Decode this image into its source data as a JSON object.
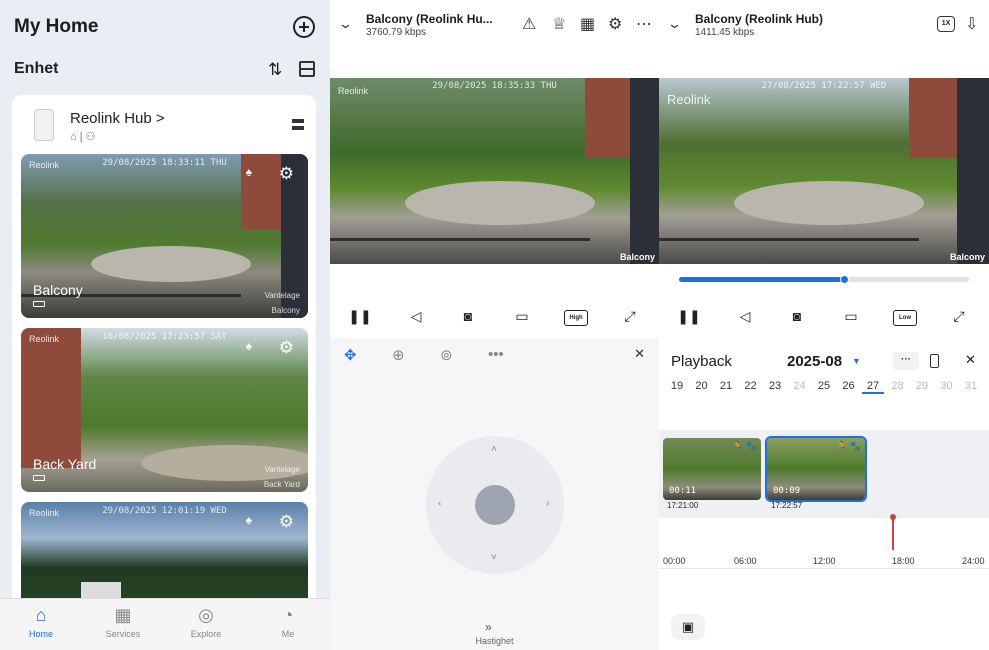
{
  "left": {
    "title": "My Home",
    "section": "Enhet",
    "hub": {
      "name": "Reolink Hub",
      "arrow": ">"
    },
    "cameras": [
      {
        "name": "Balcony",
        "timestamp": "29/08/2025 18:33:11 THU",
        "logo": "Reolink",
        "tag": "Vantelage",
        "label": "Balcony"
      },
      {
        "name": "Back Yard",
        "timestamp": "16/08/2025 17:23:57 SAT",
        "logo": "Reolink",
        "tag": "Vantelage",
        "label": "Back Yard"
      },
      {
        "name": "",
        "timestamp": "29/08/2025 12:01:19 WED",
        "logo": "Reolink",
        "tag": "",
        "label": ""
      }
    ],
    "tabs": [
      {
        "label": "Home",
        "icon": "home-icon",
        "glyph": "⌂",
        "active": true
      },
      {
        "label": "Services",
        "icon": "grid-icon",
        "glyph": "▦",
        "active": false
      },
      {
        "label": "Explore",
        "icon": "compass-icon",
        "glyph": "◎",
        "active": false
      },
      {
        "label": "Me",
        "icon": "person-icon",
        "glyph": "◔",
        "active": false
      }
    ]
  },
  "live": {
    "title": "Balcony (Reolink Hu...",
    "bitrate": "3760.79 kbps",
    "timestamp": "29/08/2025 18:35:33 THU",
    "logo": "Reolink",
    "camera_label": "Balcony",
    "quality_label": "High",
    "speed_label": "Hastighet"
  },
  "playback": {
    "title": "Balcony (Reolink Hub)",
    "bitrate": "1411.45 kbps",
    "speed_badge": "1X",
    "timestamp": "27/08/2025 17:22:57 WED",
    "logo": "Reolink",
    "camera_label": "Balcony",
    "progress": 0.57,
    "quality_label": "Low",
    "heading": "Playback",
    "month": "2025-08",
    "more_label": "···",
    "days": [
      {
        "d": "19",
        "state": "normal"
      },
      {
        "d": "20",
        "state": "normal"
      },
      {
        "d": "21",
        "state": "normal"
      },
      {
        "d": "22",
        "state": "normal"
      },
      {
        "d": "23",
        "state": "normal"
      },
      {
        "d": "24",
        "state": "dim"
      },
      {
        "d": "25",
        "state": "normal"
      },
      {
        "d": "26",
        "state": "normal"
      },
      {
        "d": "27",
        "state": "selected"
      },
      {
        "d": "28",
        "state": "dim"
      },
      {
        "d": "29",
        "state": "dim"
      },
      {
        "d": "30",
        "state": "dim"
      },
      {
        "d": "31",
        "state": "dim"
      }
    ],
    "clips": [
      {
        "duration": "00:11",
        "time": "17:21:00",
        "selected": false
      },
      {
        "duration": "00:09",
        "time": "17:22:57",
        "selected": true
      }
    ],
    "timeline_labels": [
      "00:00",
      "06:00",
      "12:00",
      "18:00",
      "24:00"
    ]
  },
  "colors": {
    "accent": "#1e6ee6",
    "marker": "#d63d3d"
  }
}
